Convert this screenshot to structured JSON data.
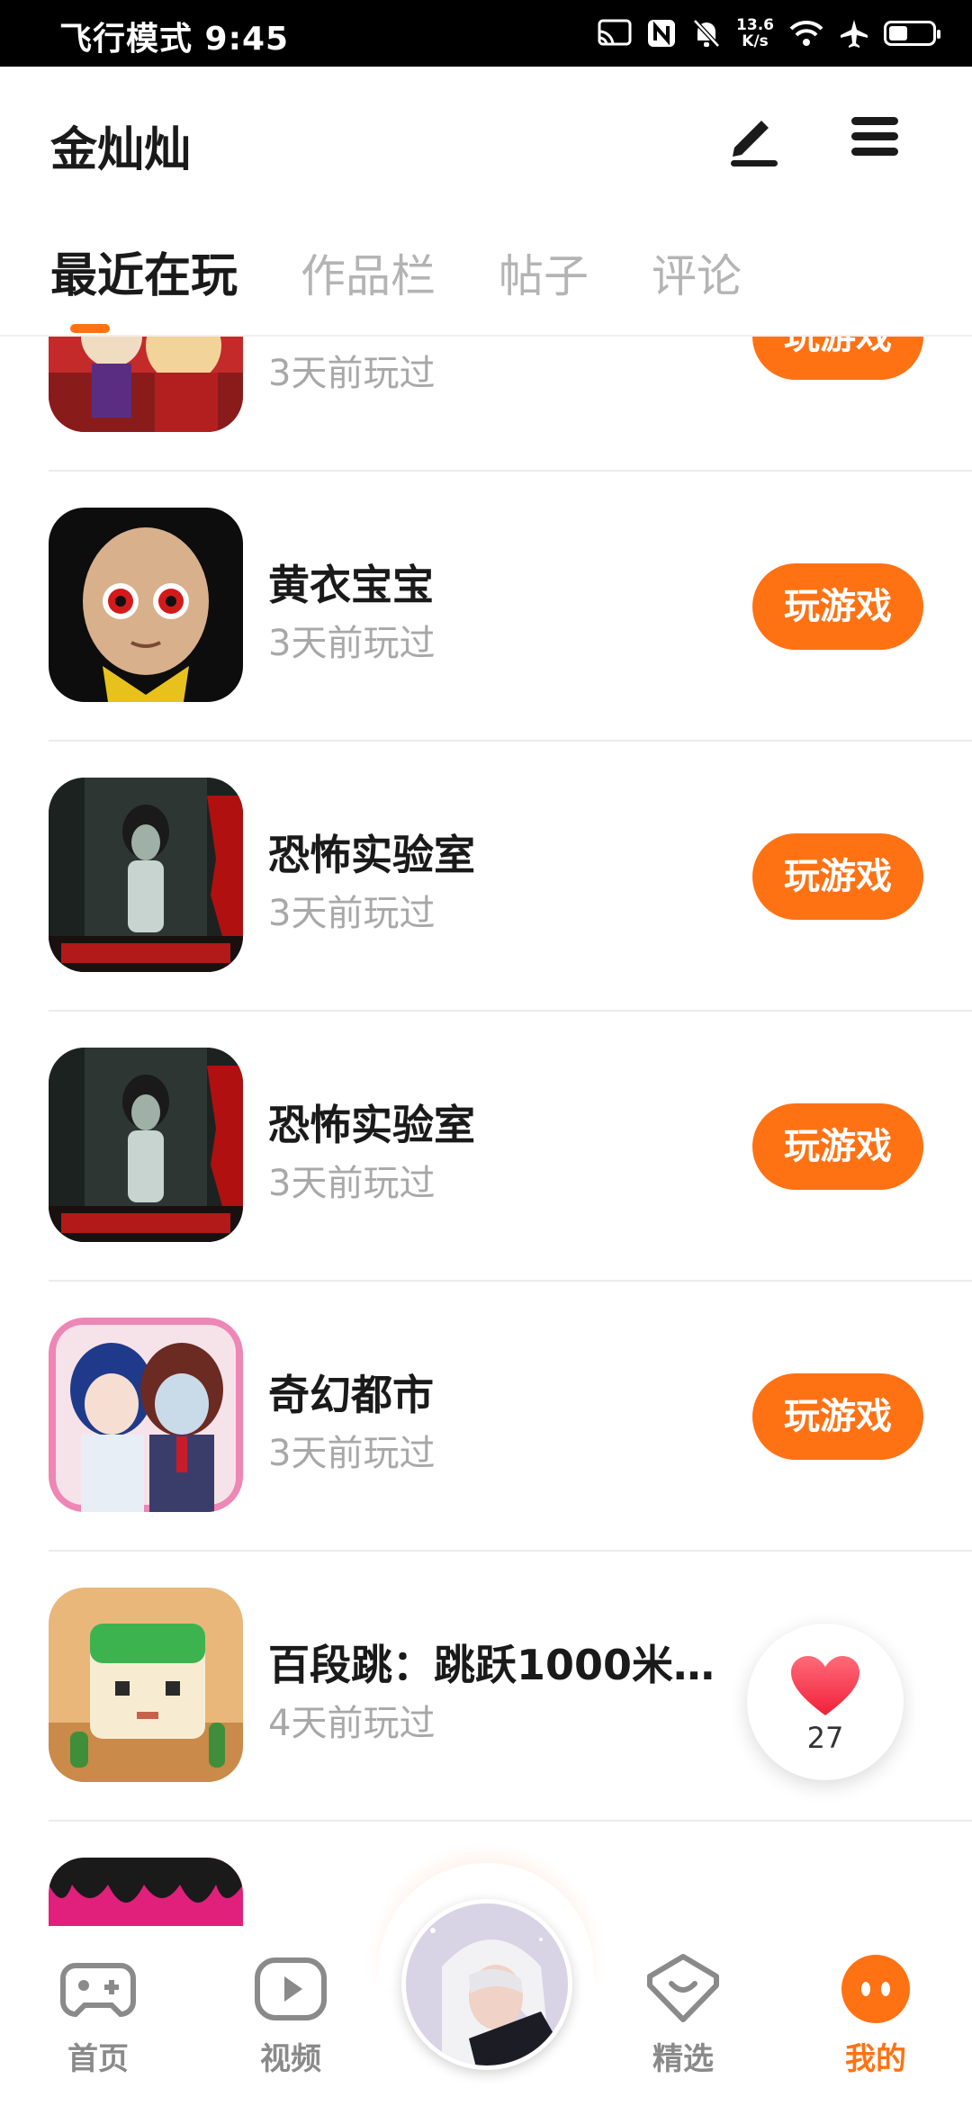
{
  "status_bar": {
    "left_text": "飞行模式 9:45",
    "speed_value": "13.6",
    "speed_unit": "K/s"
  },
  "header": {
    "username": "金灿灿",
    "edit_icon": "edit-icon",
    "menu_icon": "menu-icon"
  },
  "tabs": [
    {
      "label": "最近在玩",
      "active": true
    },
    {
      "label": "作品栏",
      "active": false
    },
    {
      "label": "帖子",
      "active": false
    },
    {
      "label": "评论",
      "active": false
    }
  ],
  "games": [
    {
      "name": "",
      "last_played": "3天前玩过",
      "button": "玩游戏"
    },
    {
      "name": "黄衣宝宝",
      "last_played": "3天前玩过",
      "button": "玩游戏"
    },
    {
      "name": "恐怖实验室",
      "last_played": "3天前玩过",
      "button": "玩游戏"
    },
    {
      "name": "恐怖实验室",
      "last_played": "3天前玩过",
      "button": "玩游戏"
    },
    {
      "name": "奇幻都市",
      "last_played": "3天前玩过",
      "button": "玩游戏"
    },
    {
      "name": "百段跳：跳跃1000米…",
      "last_played": "4天前玩过",
      "button": ""
    }
  ],
  "like_fab": {
    "count": "27"
  },
  "bottom_nav": [
    {
      "label": "首页",
      "icon": "gamepad-icon",
      "active": false
    },
    {
      "label": "视频",
      "icon": "play-icon",
      "active": false
    },
    {
      "label": "精选",
      "icon": "heart-badge-icon",
      "active": false
    },
    {
      "label": "我的",
      "icon": "face-icon",
      "active": true
    }
  ],
  "colors": {
    "accent": "#ff7214",
    "muted_text": "#a8a8a8",
    "inactive_tab": "#b4b4b4"
  }
}
